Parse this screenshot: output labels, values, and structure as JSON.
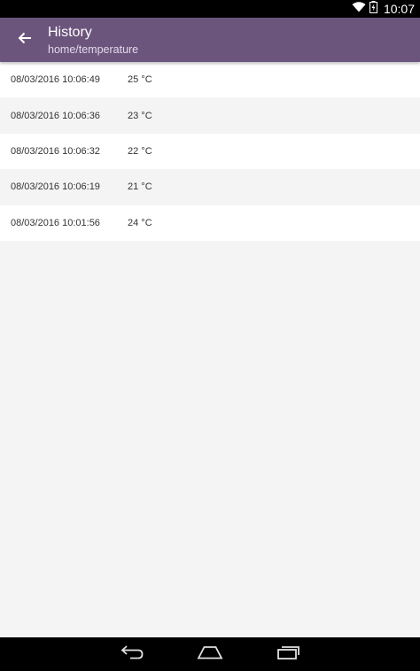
{
  "status_bar": {
    "time": "10:07",
    "icons": [
      "wifi-icon",
      "battery-icon"
    ]
  },
  "app_bar": {
    "title": "History",
    "subtitle": "home/temperature",
    "back_icon": "arrow-left-icon",
    "color": "#6c557d"
  },
  "history": {
    "rows": [
      {
        "time": "08/03/2016 10:06:49",
        "value": "25 °C"
      },
      {
        "time": "08/03/2016 10:06:36",
        "value": "23 °C"
      },
      {
        "time": "08/03/2016 10:06:32",
        "value": "22 °C"
      },
      {
        "time": "08/03/2016 10:06:19",
        "value": "21 °C"
      },
      {
        "time": "08/03/2016 10:01:56",
        "value": "24 °C"
      }
    ]
  },
  "nav_bar": {
    "icons": [
      "back-nav-icon",
      "home-nav-icon",
      "recents-nav-icon"
    ]
  }
}
